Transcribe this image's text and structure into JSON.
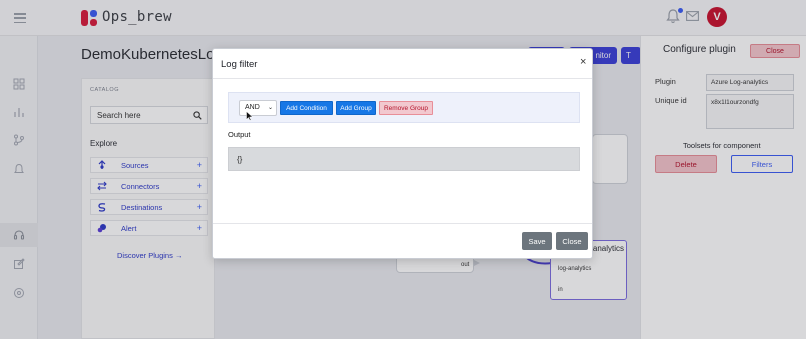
{
  "app": {
    "name": "Ops_brew",
    "avatar_initial": "V"
  },
  "page": {
    "title": "DemoKubernetesLog",
    "header_buttons": [
      "",
      "nitor",
      "T"
    ]
  },
  "catalog": {
    "label": "CATALOG",
    "search_placeholder": "Search here",
    "explore_label": "Explore",
    "items": [
      {
        "label": "Sources",
        "icon": "source-icon"
      },
      {
        "label": "Connectors",
        "icon": "connector-icon"
      },
      {
        "label": "Destinations",
        "icon": "destination-icon"
      },
      {
        "label": "Alert",
        "icon": "alert-icon"
      }
    ],
    "discover_link": "Discover Plugins"
  },
  "canvas": {
    "node_out_label": "out",
    "azure_node": {
      "title": "analytics",
      "subtitle": "log-analytics",
      "in_label": "in"
    }
  },
  "right_panel": {
    "title": "Configure plugin",
    "close_label": "Close",
    "plugin_label": "Plugin",
    "plugin_value": "Azure Log-analytics",
    "unique_id_label": "Unique id",
    "unique_id_value": "x8x1l1ourzondfg",
    "toolsets_label": "Toolsets for component",
    "delete_label": "Delete",
    "filters_label": "Filters"
  },
  "modal": {
    "title": "Log filter",
    "close_icon": "×",
    "operator_selected": "AND",
    "add_condition_label": "Add Condition",
    "add_group_label": "Add Group",
    "remove_group_label": "Remove Group",
    "output_label": "Output",
    "output_value": "{}",
    "save_label": "Save",
    "close_label": "Close"
  },
  "colors": {
    "primary_button": "#1677e6",
    "brand_indigo": "#3a3fd8",
    "danger_text": "#b3122b",
    "avatar_bg": "#c8102e"
  }
}
